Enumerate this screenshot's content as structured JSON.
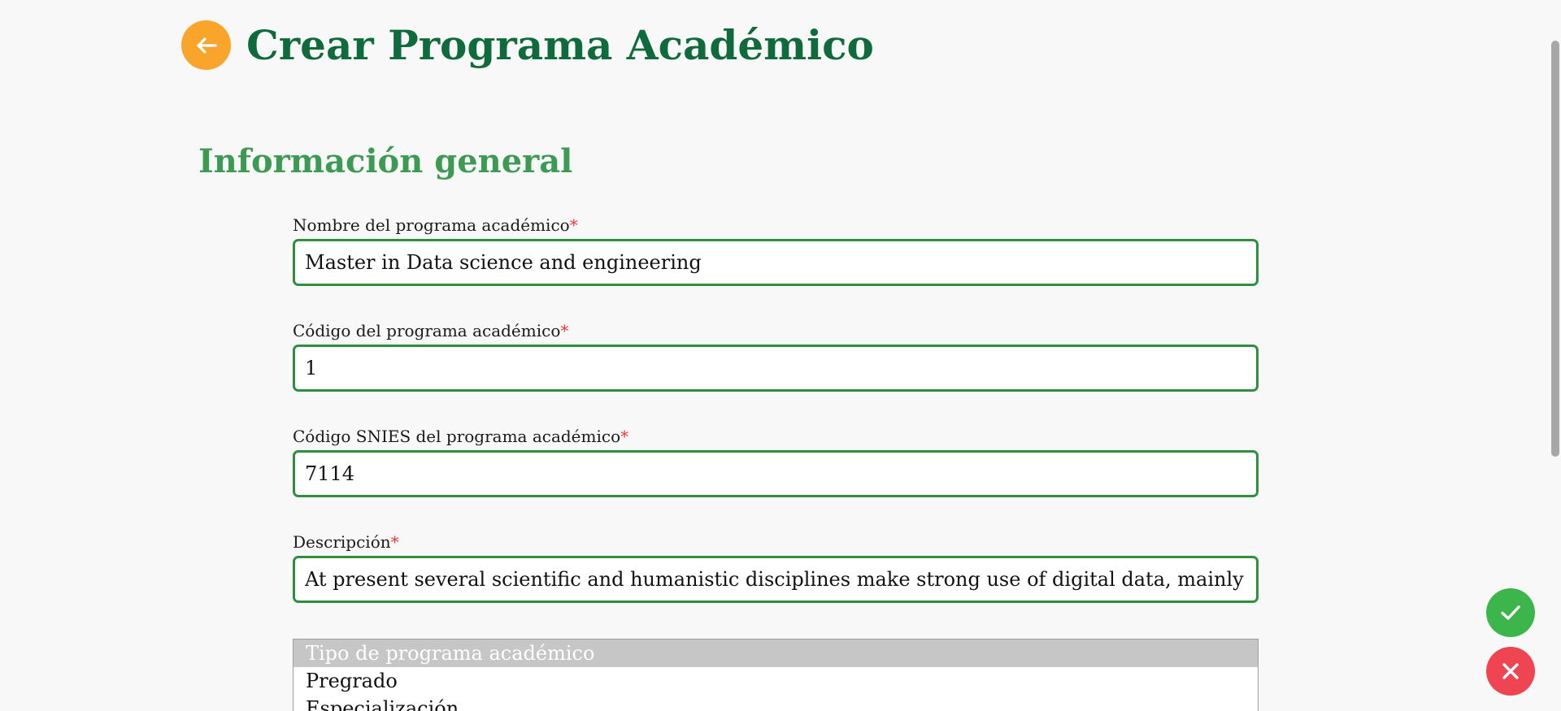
{
  "header": {
    "title": "Crear Programa Académico",
    "back_icon": "arrow-left-icon"
  },
  "section": {
    "title": "Información general"
  },
  "fields": {
    "name": {
      "label": "Nombre del programa académico",
      "required_mark": "*",
      "value": "Master in Data science and engineering"
    },
    "code": {
      "label": "Código del programa académico",
      "required_mark": "*",
      "value": "1"
    },
    "snies": {
      "label": "Código SNIES del programa académico",
      "required_mark": "*",
      "value": "7114"
    },
    "description": {
      "label": "Descripción",
      "required_mark": "*",
      "value": "At present several scientific and humanistic disciplines make strong use of digital data, mainly in c"
    }
  },
  "program_type": {
    "placeholder": "Tipo de programa académico",
    "options": [
      "Pregrado",
      "Especialización"
    ]
  },
  "actions": {
    "confirm_icon": "checkmark-icon",
    "cancel_icon": "close-icon"
  },
  "colors": {
    "title_green": "#0f6b3c",
    "section_green": "#3c9a52",
    "input_border": "#2f8f3f",
    "back_button": "#f9a42a",
    "confirm": "#3cb54a",
    "cancel": "#ef4452",
    "required": "#e53935"
  }
}
